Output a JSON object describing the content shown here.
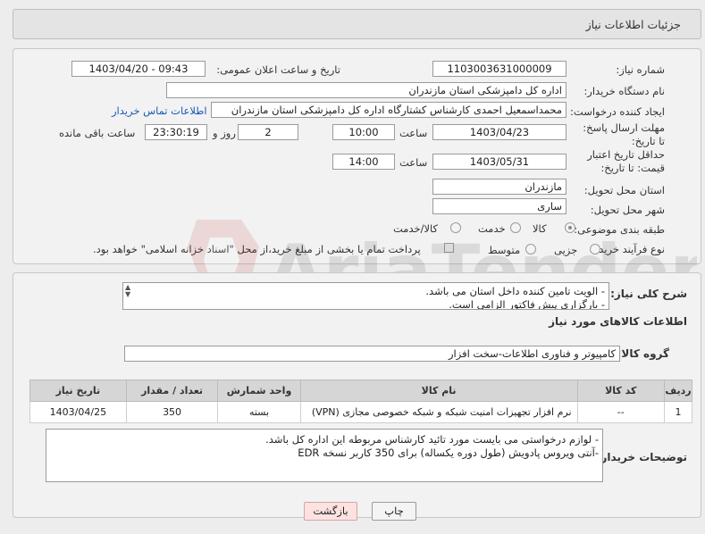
{
  "header": {
    "title": "جزئیات اطلاعات نیاز"
  },
  "form": {
    "need_number_label": "شماره نیاز:",
    "need_number_value": "1103003631000009",
    "announce_label": "تاریخ و ساعت اعلان عمومی:",
    "announce_value": "1403/04/20 - 09:43",
    "buyer_org_label": "نام دستگاه خریدار:",
    "buyer_org_value": "اداره کل دامپزشکی استان مازندران",
    "creator_label": "ایجاد کننده درخواست:",
    "creator_value": "محمداسمعیل احمدی کارشناس کشتارگاه اداره کل دامپزشکی استان مازندران",
    "contact_link": "اطلاعات تماس خریدار",
    "reply_deadline_label": "مهلت ارسال پاسخ: تا تاریخ:",
    "reply_date": "1403/04/23",
    "time_label": "ساعت",
    "reply_time": "10:00",
    "days_value": "2",
    "days_label": "روز و",
    "remaining_time": "23:30:19",
    "remaining_label": "ساعت باقی مانده",
    "validity_label": "حداقل تاریخ اعتبار قیمت: تا تاریخ:",
    "validity_date": "1403/05/31",
    "validity_time": "14:00",
    "province_label": "استان محل تحویل:",
    "province_value": "مازندران",
    "city_label": "شهر محل تحویل:",
    "city_value": "ساری",
    "category_label": "طبقه بندی موضوعی:",
    "category_options": [
      "کالا",
      "خدمت",
      "کالا/خدمت"
    ],
    "process_label": "نوع فرآیند خرید :",
    "process_options": [
      "جزیی",
      "متوسط"
    ],
    "process_note": "پرداخت تمام یا بخشی از مبلغ خرید،از محل \"اسناد خزانه اسلامی\" خواهد بود."
  },
  "description": {
    "label": "شرح کلی نیاز:",
    "lines": [
      "- الویت تامین کننده داخل استان می باشد.",
      "- بارگزاری پیش فاکتور الزامی است."
    ]
  },
  "goods": {
    "section_title": "اطلاعات کالاهای مورد نیاز",
    "group_label": "گروه کالا:",
    "group_value": "کامپیوتر و فناوری اطلاعات-سخت افزار",
    "columns": [
      "ردیف",
      "کد کالا",
      "نام کالا",
      "واحد شمارش",
      "تعداد / مقدار",
      "تاریخ نیاز"
    ],
    "rows": [
      [
        "1",
        "--",
        "نرم افزار تجهیزات امنیت شبکه و شبکه خصوصی مجازی (VPN)",
        "بسته",
        "350",
        "1403/04/25"
      ]
    ]
  },
  "buyer_notes": {
    "label": "توضیحات خریدار:",
    "lines": [
      "- لوازم درخواستی می بایست مورد تائید کارشناس مربوطه این اداره کل باشد.",
      "-آنتی ویروس پادویش (طول دوره یکساله) برای 350 کاربر نسخه EDR"
    ]
  },
  "buttons": {
    "print": "چاپ",
    "back": "بازگشت"
  },
  "watermark": {
    "text": "AriaTender.neT"
  }
}
